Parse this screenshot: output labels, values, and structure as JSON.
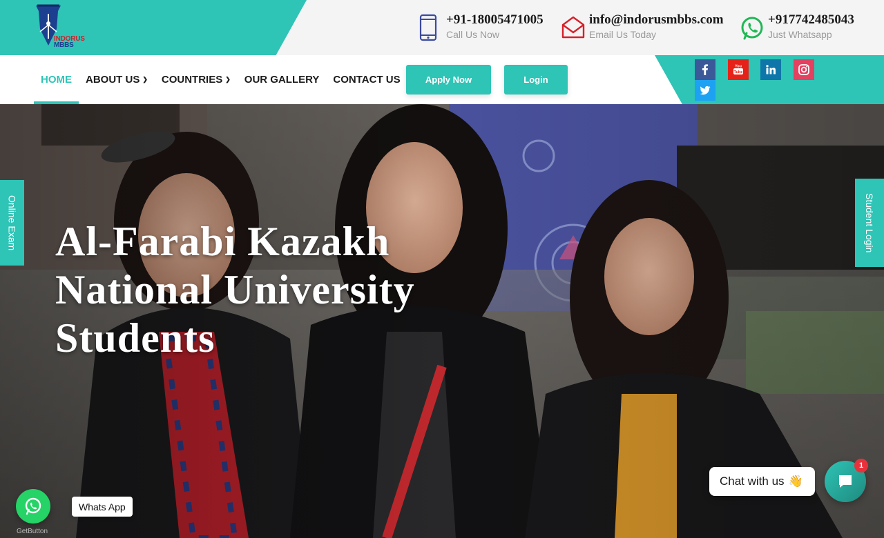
{
  "brand": {
    "logo_text_line1": "INDORUS",
    "logo_text_line2": "MBBS",
    "accent": "#2ec4b6"
  },
  "contacts": [
    {
      "main": "+91-18005471005",
      "sub": "Call Us Now",
      "icon": "mobile-phone-icon"
    },
    {
      "main": "info@indorusmbbs.com",
      "sub": "Email Us Today",
      "icon": "envelope-icon"
    },
    {
      "main": "+917742485043",
      "sub": "Just Whatsapp",
      "icon": "whatsapp-icon"
    }
  ],
  "nav": {
    "items": [
      {
        "label": "HOME",
        "active": true
      },
      {
        "label": "ABOUT US",
        "dropdown": true
      },
      {
        "label": "COUNTRIES",
        "dropdown": true
      },
      {
        "label": "OUR GALLERY"
      },
      {
        "label": "CONTACT US"
      }
    ],
    "apply_label": "Apply Now",
    "login_label": "Login"
  },
  "social": [
    {
      "name": "facebook-icon",
      "color": "#3b5998"
    },
    {
      "name": "youtube-icon",
      "color": "#e62117"
    },
    {
      "name": "linkedin-icon",
      "color": "#0e76a8"
    },
    {
      "name": "instagram-icon",
      "color": "#e4405f"
    },
    {
      "name": "twitter-icon",
      "color": "#1da1f2"
    }
  ],
  "hero": {
    "title_line1": "Al-Farabi Kazakh",
    "title_line2": "National University",
    "title_line3": "Students"
  },
  "side_tabs": {
    "left": "Online Exam",
    "right": "Student Login"
  },
  "whatsapp_widget": {
    "label": "Whats App",
    "powered_by": "GetButton"
  },
  "chat_widget": {
    "bubble_text": "Chat with us",
    "bubble_emoji": "👋",
    "badge_count": "1"
  }
}
